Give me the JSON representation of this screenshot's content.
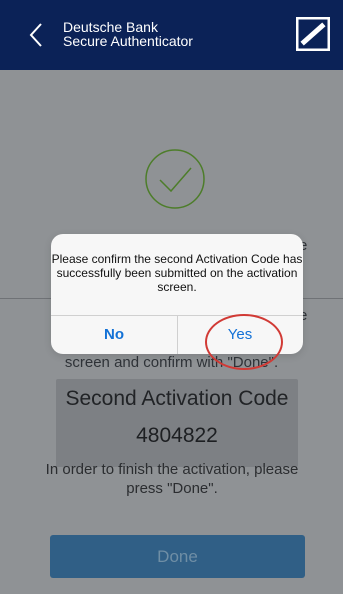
{
  "header": {
    "line1": "Deutsche Bank",
    "line2": "Secure Authenticator"
  },
  "screen": {
    "background_line1": "Y",
    "background_line1_end": "e",
    "background_line2": "T",
    "background_line2_end": "e",
    "background_line3": "screen and confirm with \"Done\".",
    "code_title": "Second Activation Code",
    "code_value": "4804822",
    "instructions": "In order to finish the activation, please press \"Done\".",
    "done_button": "Done"
  },
  "dialog": {
    "message": "Please confirm the second Activation Code has successfully been submitted on the activation screen.",
    "no": "No",
    "yes": "Yes"
  },
  "colors": {
    "header": "#0b2257",
    "accent": "#1271d6",
    "highlight": "#d13a35",
    "success": "#4d7d2a"
  }
}
